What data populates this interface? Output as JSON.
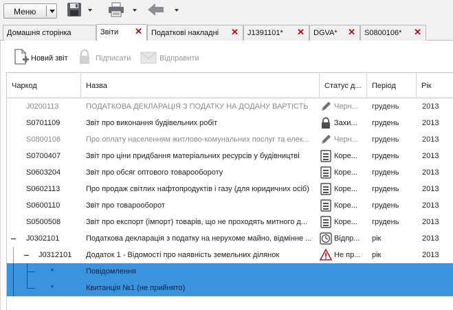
{
  "toolbar": {
    "menu_label": "Меню",
    "icons": [
      "save-icon",
      "print-icon",
      "back-arrow-icon"
    ]
  },
  "tabs": [
    {
      "label": "Домашня сторінка",
      "closable": false,
      "active": false
    },
    {
      "label": "Звіти",
      "closable": true,
      "active": true
    },
    {
      "label": "Податкові накладні",
      "closable": true,
      "active": false
    },
    {
      "label": "J1391101*",
      "closable": true,
      "active": false
    },
    {
      "label": "DGVA*",
      "closable": true,
      "active": false
    },
    {
      "label": "S0800106*",
      "closable": true,
      "active": false
    }
  ],
  "actions": {
    "new_report": "Новий звіт",
    "sign": "Підписати",
    "send": "Відправити"
  },
  "grid": {
    "columns": {
      "code": "Чаркод",
      "name": "Назва",
      "status": "Статус д...",
      "period": "Період",
      "year": "Рік"
    },
    "rows": [
      {
        "code": "J0200113",
        "name": "ПОДАТКОВА ДЕКЛАРАЦІЯ З ПОДАТКУ НА ДОДАНУ ВАРТІСТЬ",
        "status": "Черн...",
        "status_icon": "pencil-icon",
        "period": "грудень",
        "year": "2013",
        "greyed": true
      },
      {
        "code": "S0701109",
        "name": "Звіт про виконання будівельних робіт",
        "status": "Захи...",
        "status_icon": "lock-icon",
        "period": "грудень",
        "year": "2013",
        "greyed": false
      },
      {
        "code": "S0800106",
        "name": "Про оплату населенням житлово-комунальних послуг та елек...",
        "status": "Черн...",
        "status_icon": "pencil-icon",
        "period": "грудень",
        "year": "2013",
        "greyed": true
      },
      {
        "code": "S0700407",
        "name": "Звіт про ціни придбання матеріальних ресурсів у будівництві",
        "status": "Коре...",
        "status_icon": "document-icon",
        "period": "грудень",
        "year": "2013",
        "greyed": false
      },
      {
        "code": "S0603204",
        "name": "Звіт про обсяг оптового товарообороту",
        "status": "Коре...",
        "status_icon": "document-icon",
        "period": "грудень",
        "year": "2013",
        "greyed": false
      },
      {
        "code": "S0602113",
        "name": "Про продаж світлих нафтопродуктів і газу (для юридичних осіб)",
        "status": "Коре...",
        "status_icon": "document-icon",
        "period": "грудень",
        "year": "2013",
        "greyed": false
      },
      {
        "code": "S0600110",
        "name": "Звіт про товарооборот",
        "status": "Коре...",
        "status_icon": "document-icon",
        "period": "грудень",
        "year": "2013",
        "greyed": false
      },
      {
        "code": "S0500508",
        "name": "Звіт про експорт (імпорт) товарів, що не проходять митного д...",
        "status": "Коре...",
        "status_icon": "document-icon",
        "period": "грудень",
        "year": "2013",
        "greyed": false
      },
      {
        "code": "J0302101",
        "name": "Податкова декларація з податку на нерухоме майно, відмінне ...",
        "status": "Відпр...",
        "status_icon": "clock-icon",
        "period": "рік",
        "year": "2013",
        "greyed": false
      },
      {
        "code": "J0312101",
        "name": "Додаток 1 - Відомості про наявність земельних ділянок",
        "status": "Не пр...",
        "status_icon": "warning-icon",
        "period": "рік",
        "year": "2013",
        "greyed": false
      },
      {
        "code": "*",
        "name": "Повідомлення",
        "status": "",
        "status_icon": "",
        "period": "",
        "year": "",
        "greyed": false
      },
      {
        "code": "*",
        "name": "Квитанція №1 (не прийнято)",
        "status": "",
        "status_icon": "",
        "period": "",
        "year": "",
        "greyed": false
      }
    ]
  },
  "colors": {
    "selection": "#3b93dd",
    "close_x": "#a1141c",
    "warning": "#c0161b"
  }
}
